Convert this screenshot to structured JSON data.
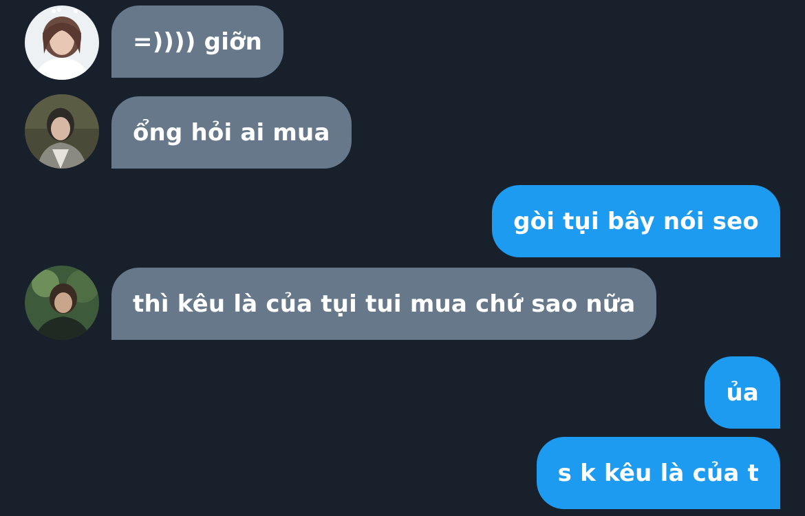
{
  "conversation": {
    "messages": [
      {
        "direction": "incoming",
        "text": "=)))) giỡn",
        "avatar_icon": "user-avatar-1"
      },
      {
        "direction": "incoming",
        "text": "ổng hỏi ai mua",
        "avatar_icon": "user-avatar-2"
      },
      {
        "direction": "outgoing",
        "text": "gòi tụi bây nói seo"
      },
      {
        "direction": "incoming",
        "text": "thì kêu là của tụi tui mua chứ sao nữa",
        "avatar_icon": "user-avatar-3"
      },
      {
        "direction": "outgoing",
        "text": "ủa"
      },
      {
        "direction": "outgoing",
        "text": "s k kêu là của t"
      }
    ]
  },
  "colors": {
    "background": "#17202b",
    "incoming_bubble": "#66788a",
    "outgoing_bubble": "#1d9bf0",
    "text": "#ffffff"
  }
}
